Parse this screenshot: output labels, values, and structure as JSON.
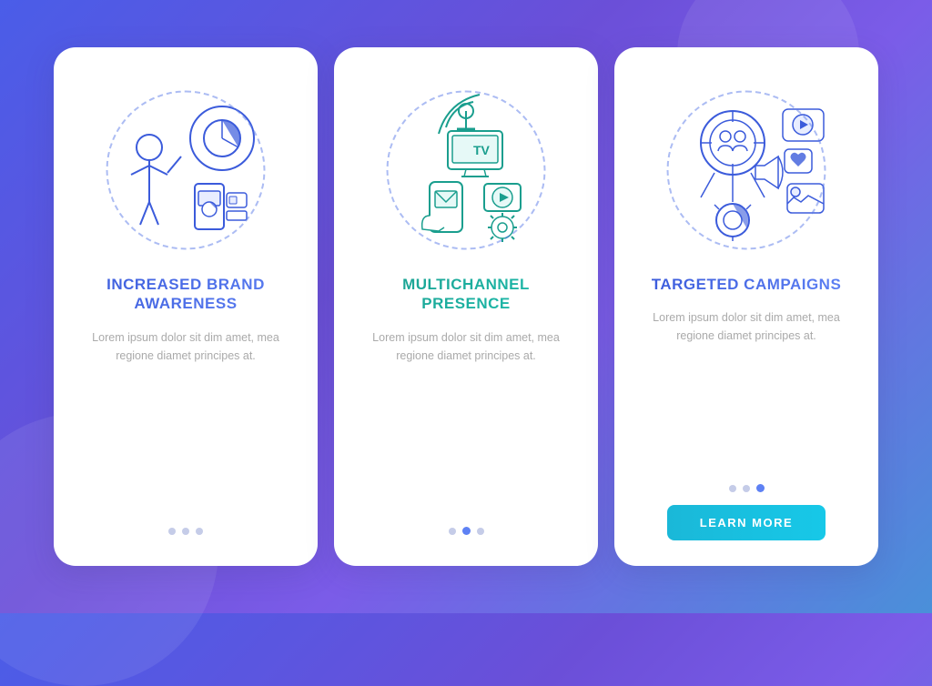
{
  "background": {
    "gradient_start": "#4a5de8",
    "gradient_end": "#4a90d9"
  },
  "cards": [
    {
      "id": "card-brand-awareness",
      "title": "INCREASED BRAND AWARENESS",
      "title_style": "blue-grad",
      "description": "Lorem ipsum dolor sit dim amet, mea regione diamet principes at.",
      "dots": [
        {
          "active": false
        },
        {
          "active": false
        },
        {
          "active": false
        }
      ],
      "has_button": false,
      "illustration": "brand_awareness"
    },
    {
      "id": "card-multichannel",
      "title": "MULTICHANNEL PRESENCE",
      "title_style": "teal-grad",
      "description": "Lorem ipsum dolor sit dim amet, mea regione diamet principes at.",
      "dots": [
        {
          "active": false
        },
        {
          "active": true
        },
        {
          "active": false
        }
      ],
      "has_button": false,
      "illustration": "multichannel"
    },
    {
      "id": "card-targeted",
      "title": "TARGETED CAMPAIGNS",
      "title_style": "purple-grad",
      "description": "Lorem ipsum dolor sit dim amet, mea regione diamet principes at.",
      "dots": [
        {
          "active": false
        },
        {
          "active": false
        },
        {
          "active": true
        }
      ],
      "has_button": true,
      "button_label": "LEARN MORE",
      "illustration": "targeted"
    }
  ]
}
